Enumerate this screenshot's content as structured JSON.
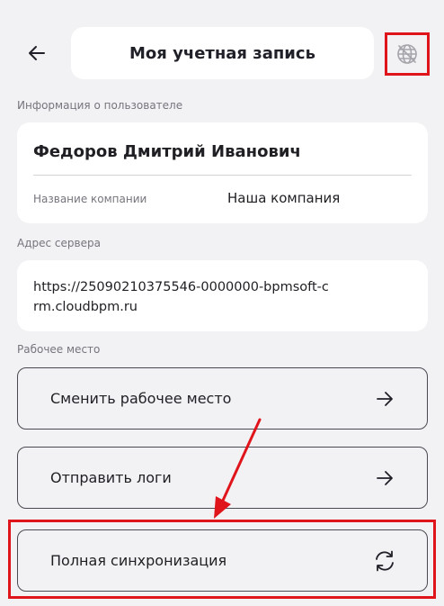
{
  "header": {
    "title": "Моя учетная запись",
    "back_icon": "arrow-left-icon",
    "offline_icon": "globe-off-icon"
  },
  "user_info": {
    "section_label": "Информация о пользователе",
    "name": "Федоров Дмитрий Иванович",
    "company_label": "Название компании",
    "company_value": "Наша компания"
  },
  "server": {
    "section_label": "Адрес сервера",
    "url": "https://25090210375546-0000000-bpmsoft-crm.cloudbpm.ru"
  },
  "workplace": {
    "section_label": "Рабочее место",
    "actions": [
      {
        "label": "Сменить рабочее место",
        "icon": "arrow-right-icon"
      },
      {
        "label": "Отправить логи",
        "icon": "arrow-right-icon"
      },
      {
        "label": "Полная синхронизация",
        "icon": "sync-icon"
      }
    ]
  },
  "colors": {
    "background": "#f2f2f4",
    "card": "#ffffff",
    "text": "#1f1f24",
    "muted_text": "#75757d",
    "annotation_red": "#e0141b"
  }
}
